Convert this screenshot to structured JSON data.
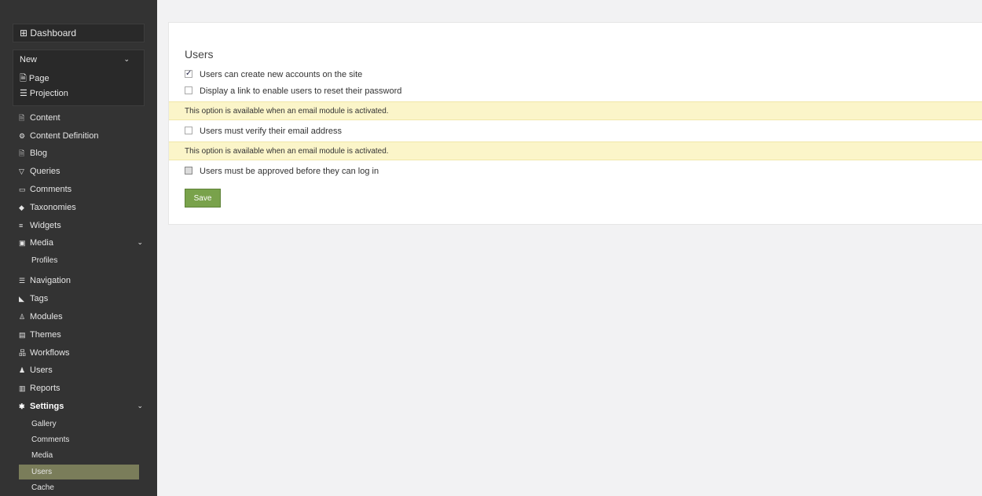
{
  "sidebar": {
    "dashboard": "⊞ Dashboard",
    "new_header": "New",
    "new_items": [
      "🗎 Page",
      "☰ Projection"
    ],
    "items": [
      {
        "icon": "🗎",
        "label": "Content"
      },
      {
        "icon": "⚙",
        "label": "Content Definition"
      },
      {
        "icon": "🗎",
        "label": "Blog"
      },
      {
        "icon": "▽",
        "label": "Queries"
      },
      {
        "icon": "▭",
        "label": "Comments"
      },
      {
        "icon": "◆",
        "label": "Taxonomies"
      },
      {
        "icon": "≡",
        "label": "Widgets"
      },
      {
        "icon": "▣",
        "label": "Media"
      },
      {
        "icon": "",
        "label": "Profiles"
      },
      {
        "icon": "☰",
        "label": "Navigation"
      },
      {
        "icon": "◣",
        "label": "Tags"
      },
      {
        "icon": "♙",
        "label": "Modules"
      },
      {
        "icon": "▤",
        "label": "Themes"
      },
      {
        "icon": "品",
        "label": "Workflows"
      },
      {
        "icon": "♟",
        "label": "Users"
      },
      {
        "icon": "▥",
        "label": "Reports"
      },
      {
        "icon": "✱",
        "label": "Settings"
      },
      {
        "icon": "",
        "label": "Gallery"
      },
      {
        "icon": "",
        "label": "Comments"
      },
      {
        "icon": "",
        "label": "Media"
      },
      {
        "icon": "",
        "label": "Users"
      },
      {
        "icon": "",
        "label": "Cache"
      }
    ],
    "chevron": "⌄"
  },
  "main": {
    "title": "Users",
    "options": [
      {
        "label": "Users can create new accounts on the site",
        "checked": true
      },
      {
        "label": "Display a link to enable users to reset their password",
        "checked": false
      },
      {
        "label": "Users must verify their email address",
        "checked": false
      },
      {
        "label": "Users must be approved before they can log in",
        "checked": false
      }
    ],
    "notice": "This option is available when an email module is activated.",
    "save_label": "Save"
  },
  "colors": {
    "sidebar_bg": "#333333",
    "active_item": "#7a7d5a",
    "notice_bg": "#fbf5c9",
    "save_button": "#79a24b"
  }
}
